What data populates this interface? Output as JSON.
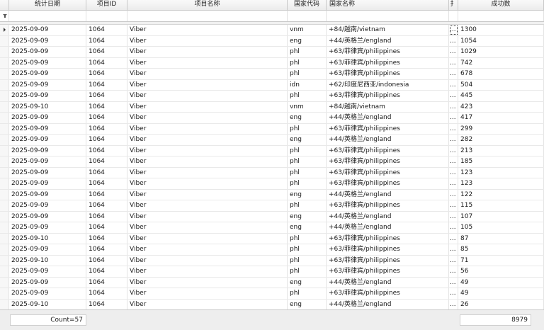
{
  "columns": [
    "统计日期",
    "项目ID",
    "项目名称",
    "国家代码",
    "国家名称",
    "扌",
    "成功数"
  ],
  "rows": [
    {
      "date": "2025-09-09",
      "pid": "1064",
      "name": "Viber",
      "code": "vnm",
      "country": "+84/越南/vietnam",
      "extra": "...",
      "success": "1300"
    },
    {
      "date": "2025-09-09",
      "pid": "1064",
      "name": "Viber",
      "code": "eng",
      "country": "+44/英格兰/england",
      "extra": "...",
      "success": "1054"
    },
    {
      "date": "2025-09-09",
      "pid": "1064",
      "name": "Viber",
      "code": "phl",
      "country": "+63/菲律宾/philippines",
      "extra": "...",
      "success": "1029"
    },
    {
      "date": "2025-09-09",
      "pid": "1064",
      "name": "Viber",
      "code": "phl",
      "country": "+63/菲律宾/philippines",
      "extra": "...",
      "success": "742"
    },
    {
      "date": "2025-09-09",
      "pid": "1064",
      "name": "Viber",
      "code": "phl",
      "country": "+63/菲律宾/philippines",
      "extra": "...",
      "success": "678"
    },
    {
      "date": "2025-09-09",
      "pid": "1064",
      "name": "Viber",
      "code": "idn",
      "country": "+62/印度尼西亚/indonesia",
      "extra": "...",
      "success": "504"
    },
    {
      "date": "2025-09-09",
      "pid": "1064",
      "name": "Viber",
      "code": "phl",
      "country": "+63/菲律宾/philippines",
      "extra": "...",
      "success": "445"
    },
    {
      "date": "2025-09-10",
      "pid": "1064",
      "name": "Viber",
      "code": "vnm",
      "country": "+84/越南/vietnam",
      "extra": "...",
      "success": "423"
    },
    {
      "date": "2025-09-09",
      "pid": "1064",
      "name": "Viber",
      "code": "eng",
      "country": "+44/英格兰/england",
      "extra": "...",
      "success": "417"
    },
    {
      "date": "2025-09-09",
      "pid": "1064",
      "name": "Viber",
      "code": "phl",
      "country": "+63/菲律宾/philippines",
      "extra": "...",
      "success": "299"
    },
    {
      "date": "2025-09-09",
      "pid": "1064",
      "name": "Viber",
      "code": "eng",
      "country": "+44/英格兰/england",
      "extra": "...",
      "success": "282"
    },
    {
      "date": "2025-09-09",
      "pid": "1064",
      "name": "Viber",
      "code": "phl",
      "country": "+63/菲律宾/philippines",
      "extra": "...",
      "success": "213"
    },
    {
      "date": "2025-09-09",
      "pid": "1064",
      "name": "Viber",
      "code": "phl",
      "country": "+63/菲律宾/philippines",
      "extra": "...",
      "success": "185"
    },
    {
      "date": "2025-09-09",
      "pid": "1064",
      "name": "Viber",
      "code": "phl",
      "country": "+63/菲律宾/philippines",
      "extra": "...",
      "success": "123"
    },
    {
      "date": "2025-09-09",
      "pid": "1064",
      "name": "Viber",
      "code": "phl",
      "country": "+63/菲律宾/philippines",
      "extra": "...",
      "success": "123"
    },
    {
      "date": "2025-09-09",
      "pid": "1064",
      "name": "Viber",
      "code": "eng",
      "country": "+44/英格兰/england",
      "extra": "...",
      "success": "122"
    },
    {
      "date": "2025-09-09",
      "pid": "1064",
      "name": "Viber",
      "code": "phl",
      "country": "+63/菲律宾/philippines",
      "extra": "...",
      "success": "115"
    },
    {
      "date": "2025-09-09",
      "pid": "1064",
      "name": "Viber",
      "code": "eng",
      "country": "+44/英格兰/england",
      "extra": "...",
      "success": "107"
    },
    {
      "date": "2025-09-09",
      "pid": "1064",
      "name": "Viber",
      "code": "eng",
      "country": "+44/英格兰/england",
      "extra": "...",
      "success": "105"
    },
    {
      "date": "2025-09-10",
      "pid": "1064",
      "name": "Viber",
      "code": "phl",
      "country": "+63/菲律宾/philippines",
      "extra": "...",
      "success": "87"
    },
    {
      "date": "2025-09-09",
      "pid": "1064",
      "name": "Viber",
      "code": "phl",
      "country": "+63/菲律宾/philippines",
      "extra": "...",
      "success": "85"
    },
    {
      "date": "2025-09-10",
      "pid": "1064",
      "name": "Viber",
      "code": "phl",
      "country": "+63/菲律宾/philippines",
      "extra": "...",
      "success": "71"
    },
    {
      "date": "2025-09-09",
      "pid": "1064",
      "name": "Viber",
      "code": "phl",
      "country": "+63/菲律宾/philippines",
      "extra": "...",
      "success": "56"
    },
    {
      "date": "2025-09-09",
      "pid": "1064",
      "name": "Viber",
      "code": "eng",
      "country": "+44/英格兰/england",
      "extra": "...",
      "success": "49"
    },
    {
      "date": "2025-09-09",
      "pid": "1064",
      "name": "Viber",
      "code": "phl",
      "country": "+63/菲律宾/philippines",
      "extra": "...",
      "success": "49"
    },
    {
      "date": "2025-09-10",
      "pid": "1064",
      "name": "Viber",
      "code": "eng",
      "country": "+44/英格兰/england",
      "extra": "...",
      "success": "26"
    }
  ],
  "footer": {
    "count": "Count=57",
    "total": "8979"
  },
  "icons": {
    "filter": "funnel-icon",
    "row_indicator": "current-row-arrow-icon"
  }
}
